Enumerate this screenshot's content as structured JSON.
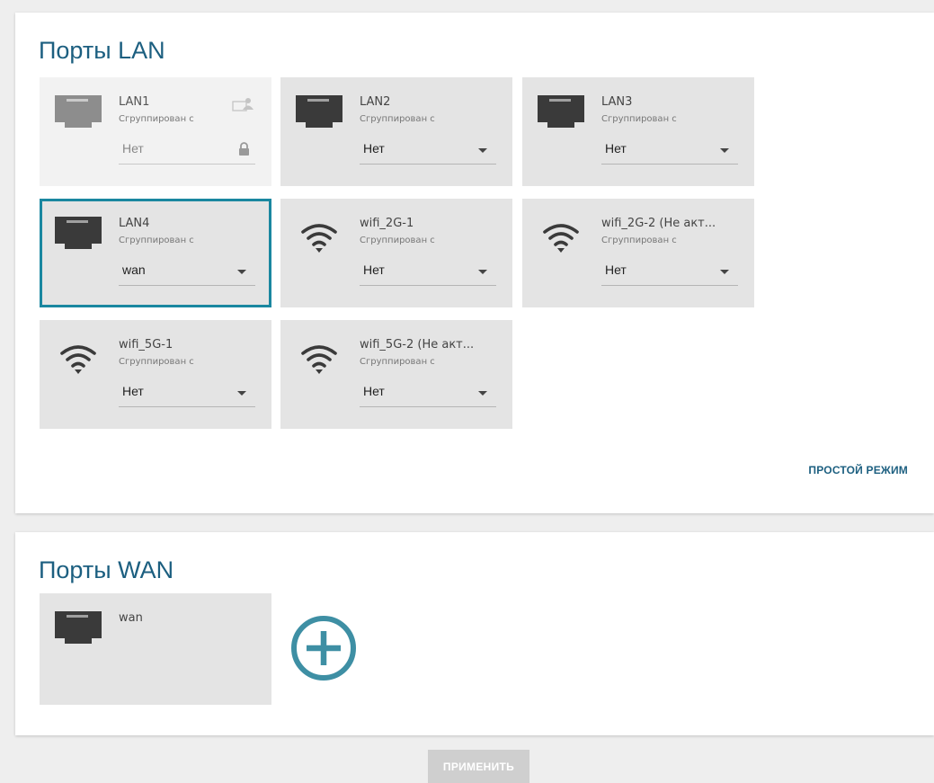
{
  "lan_section": {
    "title": "Порты LAN",
    "grouped_label": "Сгруппирован с",
    "ports": [
      {
        "name": "LAN1",
        "type": "ethernet",
        "value": "Нет",
        "disabled": true,
        "selected": false
      },
      {
        "name": "LAN2",
        "type": "ethernet",
        "value": "Нет",
        "disabled": false,
        "selected": false
      },
      {
        "name": "LAN3",
        "type": "ethernet",
        "value": "Нет",
        "disabled": false,
        "selected": false
      },
      {
        "name": "LAN4",
        "type": "ethernet",
        "value": "wan",
        "disabled": false,
        "selected": true
      },
      {
        "name": "wifi_2G-1",
        "type": "wifi",
        "value": "Нет",
        "disabled": false,
        "selected": false
      },
      {
        "name": "wifi_2G-2 (Не акт...",
        "type": "wifi",
        "value": "Нет",
        "disabled": false,
        "selected": false
      },
      {
        "name": "wifi_5G-1",
        "type": "wifi",
        "value": "Нет",
        "disabled": false,
        "selected": false
      },
      {
        "name": "wifi_5G-2 (Не акт...",
        "type": "wifi",
        "value": "Нет",
        "disabled": false,
        "selected": false
      }
    ],
    "simple_mode_label": "ПРОСТОЙ РЕЖИМ"
  },
  "wan_section": {
    "title": "Порты WAN",
    "ports": [
      {
        "name": "wan",
        "type": "ethernet"
      }
    ]
  },
  "apply_label": "ПРИМЕНИТЬ",
  "colors": {
    "accent": "#1c5f80",
    "selected_border": "#1a87a0",
    "add_button": "#3e8fa4",
    "card_bg": "#e4e4e4"
  }
}
